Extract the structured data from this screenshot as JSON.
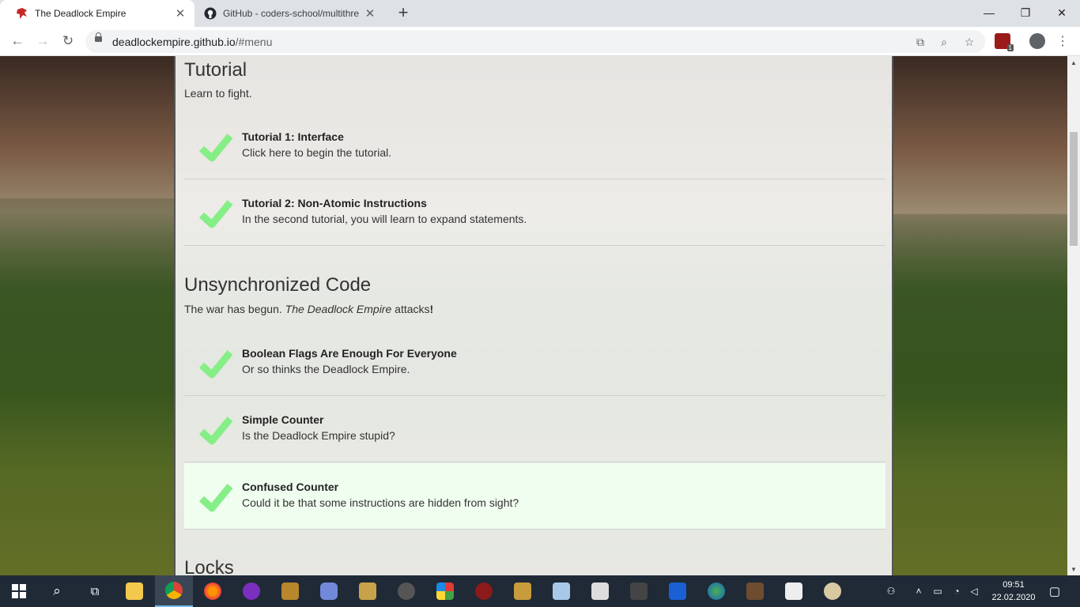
{
  "browser": {
    "tabs": [
      {
        "title": "The Deadlock Empire",
        "active": true
      },
      {
        "title": "GitHub - coders-school/multithre",
        "active": false
      }
    ],
    "url_host": "deadlockempire.github.io",
    "url_path": "/#menu",
    "extension_badge": "1"
  },
  "page": {
    "sections": [
      {
        "title": "Tutorial",
        "subtitle": "Learn to fight."
      },
      {
        "title": "Unsynchronized Code",
        "subtitle_pre": "The war has begun. ",
        "subtitle_em": "The Deadlock Empire",
        "subtitle_post": " attacks",
        "subtitle_bang": "!"
      },
      {
        "title": "Locks"
      }
    ],
    "levels": [
      {
        "title": "Tutorial 1: Interface",
        "desc": "Click here to begin the tutorial."
      },
      {
        "title": "Tutorial 2: Non-Atomic Instructions",
        "desc": "In the second tutorial, you will learn to expand statements."
      },
      {
        "title": "Boolean Flags Are Enough For Everyone",
        "desc": "Or so thinks the Deadlock Empire."
      },
      {
        "title": "Simple Counter",
        "desc": "Is the Deadlock Empire stupid?"
      },
      {
        "title": "Confused Counter",
        "desc": "Could it be that some instructions are hidden from sight?"
      }
    ]
  },
  "taskbar": {
    "time": "09:51",
    "date": "22.02.2020"
  },
  "colors": {
    "check": "#86ee86",
    "highlight": "#f0fff0",
    "taskbar": "#1f2a36"
  }
}
